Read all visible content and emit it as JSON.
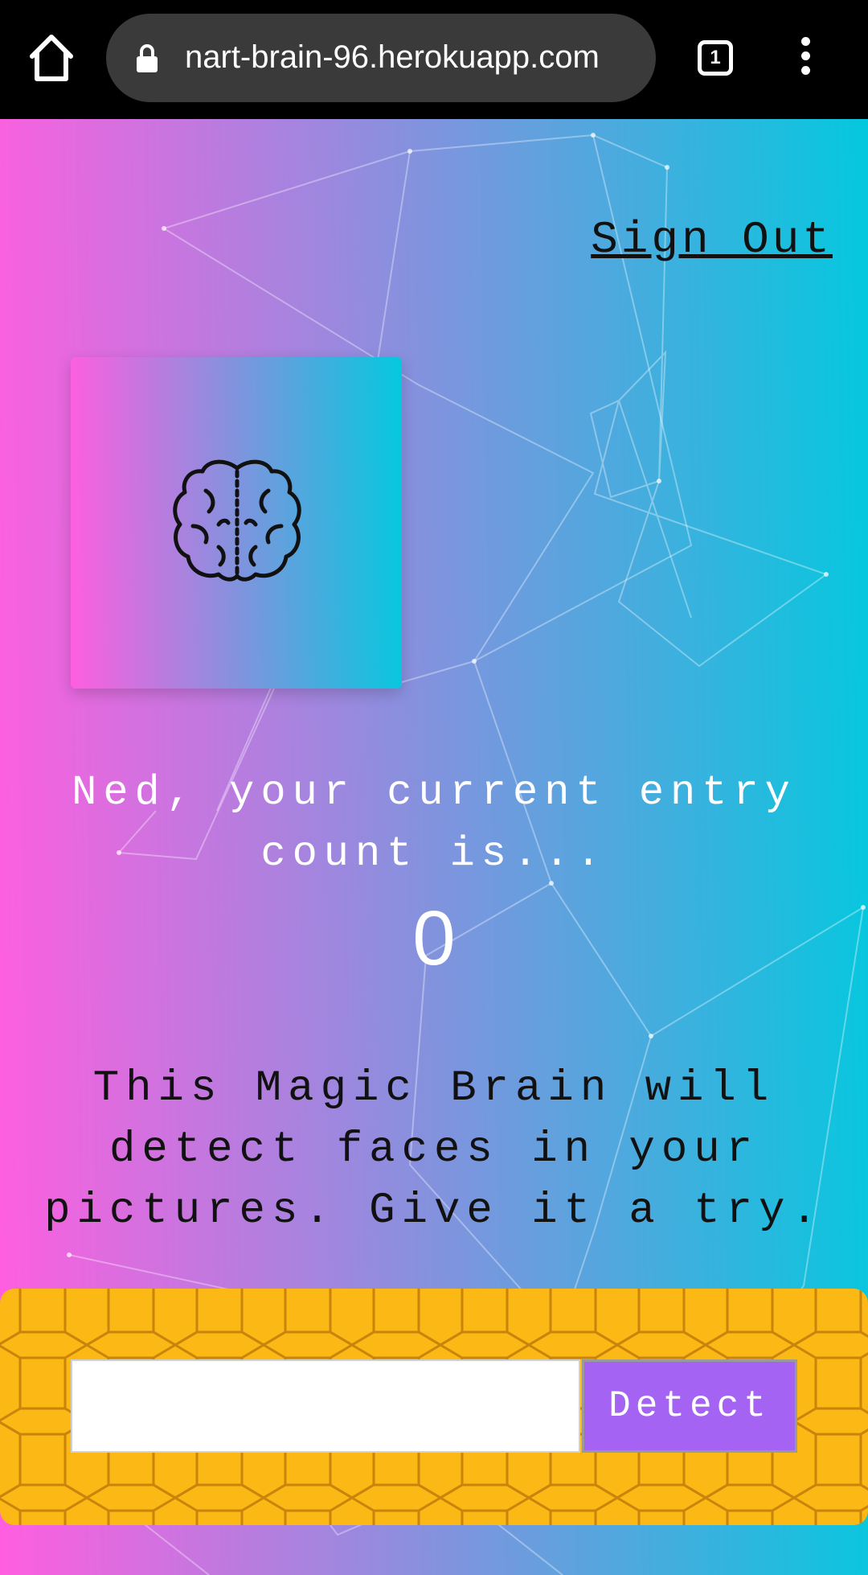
{
  "browser": {
    "url": "nart-brain-96.herokuapp.com",
    "tab_count": "1",
    "icons": [
      "home-icon",
      "lock-icon",
      "tabs-icon",
      "more-vert-icon"
    ]
  },
  "nav": {
    "sign_out_label": "Sign Out"
  },
  "logo": {
    "icon": "brain-icon"
  },
  "rank": {
    "message": "Ned, your current entry count is...",
    "count": "0"
  },
  "description": "This Magic Brain will detect faces in your pictures. Give it a try.",
  "image_form": {
    "input_value": "",
    "detect_label": "Detect"
  },
  "colors": {
    "gradient_start": "#ff5edf",
    "gradient_end": "#04c8de",
    "panel": "#fcb814",
    "button": "#a463f2"
  }
}
